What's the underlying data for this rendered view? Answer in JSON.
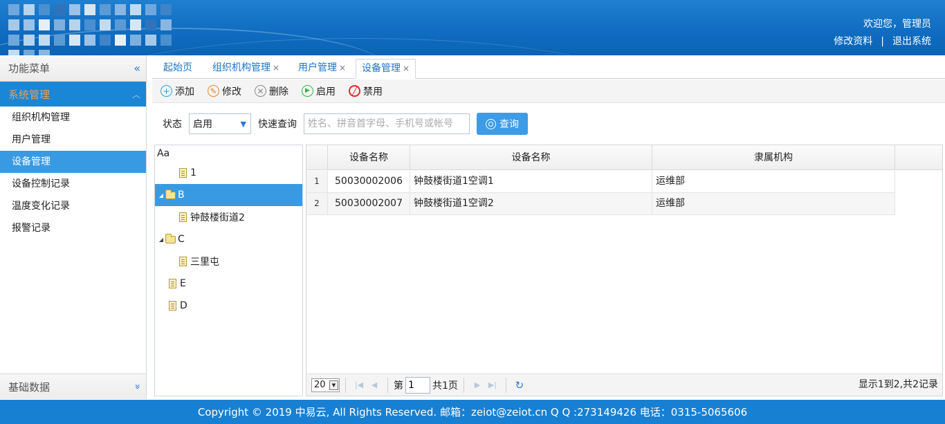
{
  "header": {
    "welcome": "欢迎您，管理员",
    "edit_profile": "修改资料",
    "separator": "|",
    "logout": "退出系统",
    "bg_color": "#0f6cc0"
  },
  "sidebar": {
    "title": "功能菜单",
    "collapse_icon": "«",
    "group": "系统管理",
    "group_icon": "︿",
    "items": [
      {
        "label": "组织机构管理"
      },
      {
        "label": "用户管理"
      },
      {
        "label": "设备管理"
      },
      {
        "label": "设备控制记录"
      },
      {
        "label": "温度变化记录"
      },
      {
        "label": "报警记录"
      }
    ],
    "active_index": 2,
    "footer_title": "基础数据",
    "footer_icon": "»"
  },
  "tabs": [
    {
      "label": "起始页",
      "closable": false
    },
    {
      "label": "组织机构管理",
      "closable": true
    },
    {
      "label": "用户管理",
      "closable": true
    },
    {
      "label": "设备管理",
      "closable": true
    }
  ],
  "tab_close": "×",
  "toolbar": {
    "add": "添加",
    "edit": "修改",
    "delete": "删除",
    "enable": "启用",
    "disable": "禁用"
  },
  "filter": {
    "status_label": "状态",
    "status_value": "启用",
    "quick_label": "快速查询",
    "search_placeholder": "姓名、拼音首字母、手机号或帐号",
    "query_button": "查询"
  },
  "tree": {
    "root": "Aa",
    "nodes": [
      {
        "label": "1",
        "type": "file",
        "indent": 2
      },
      {
        "label": "B",
        "type": "folder",
        "indent": 0,
        "expanded": true,
        "selected": true
      },
      {
        "label": "钟鼓楼街道2",
        "type": "file",
        "indent": 2
      },
      {
        "label": "C",
        "type": "folder",
        "indent": 0,
        "expanded": true
      },
      {
        "label": "三里屯",
        "type": "file",
        "indent": 2
      },
      {
        "label": "E",
        "type": "file",
        "indent": 1
      },
      {
        "label": "D",
        "type": "file",
        "indent": 1
      }
    ]
  },
  "grid": {
    "columns": [
      "设备名称",
      "设备名称",
      "隶属机构"
    ],
    "rows": [
      {
        "num": "1",
        "code": "50030002006",
        "name": "钟鼓楼街道1空调1",
        "org": "运维部"
      },
      {
        "num": "2",
        "code": "50030002007",
        "name": "钟鼓楼街道1空调2",
        "org": "运维部"
      }
    ]
  },
  "pager": {
    "page_size": "20",
    "page_label": "第",
    "page_value": "1",
    "total_pages": "共1页",
    "info": "显示1到2,共2记录"
  },
  "footer": {
    "text": "Copyright © 2019 中易云, All Rights Reserved. 邮箱：zeiot@zeiot.cn Q Q :273149426 电话：0315-5065606"
  },
  "colors": {
    "accent": "#399ae4",
    "header": "#0f6cc0",
    "footer": "#1880d2"
  }
}
